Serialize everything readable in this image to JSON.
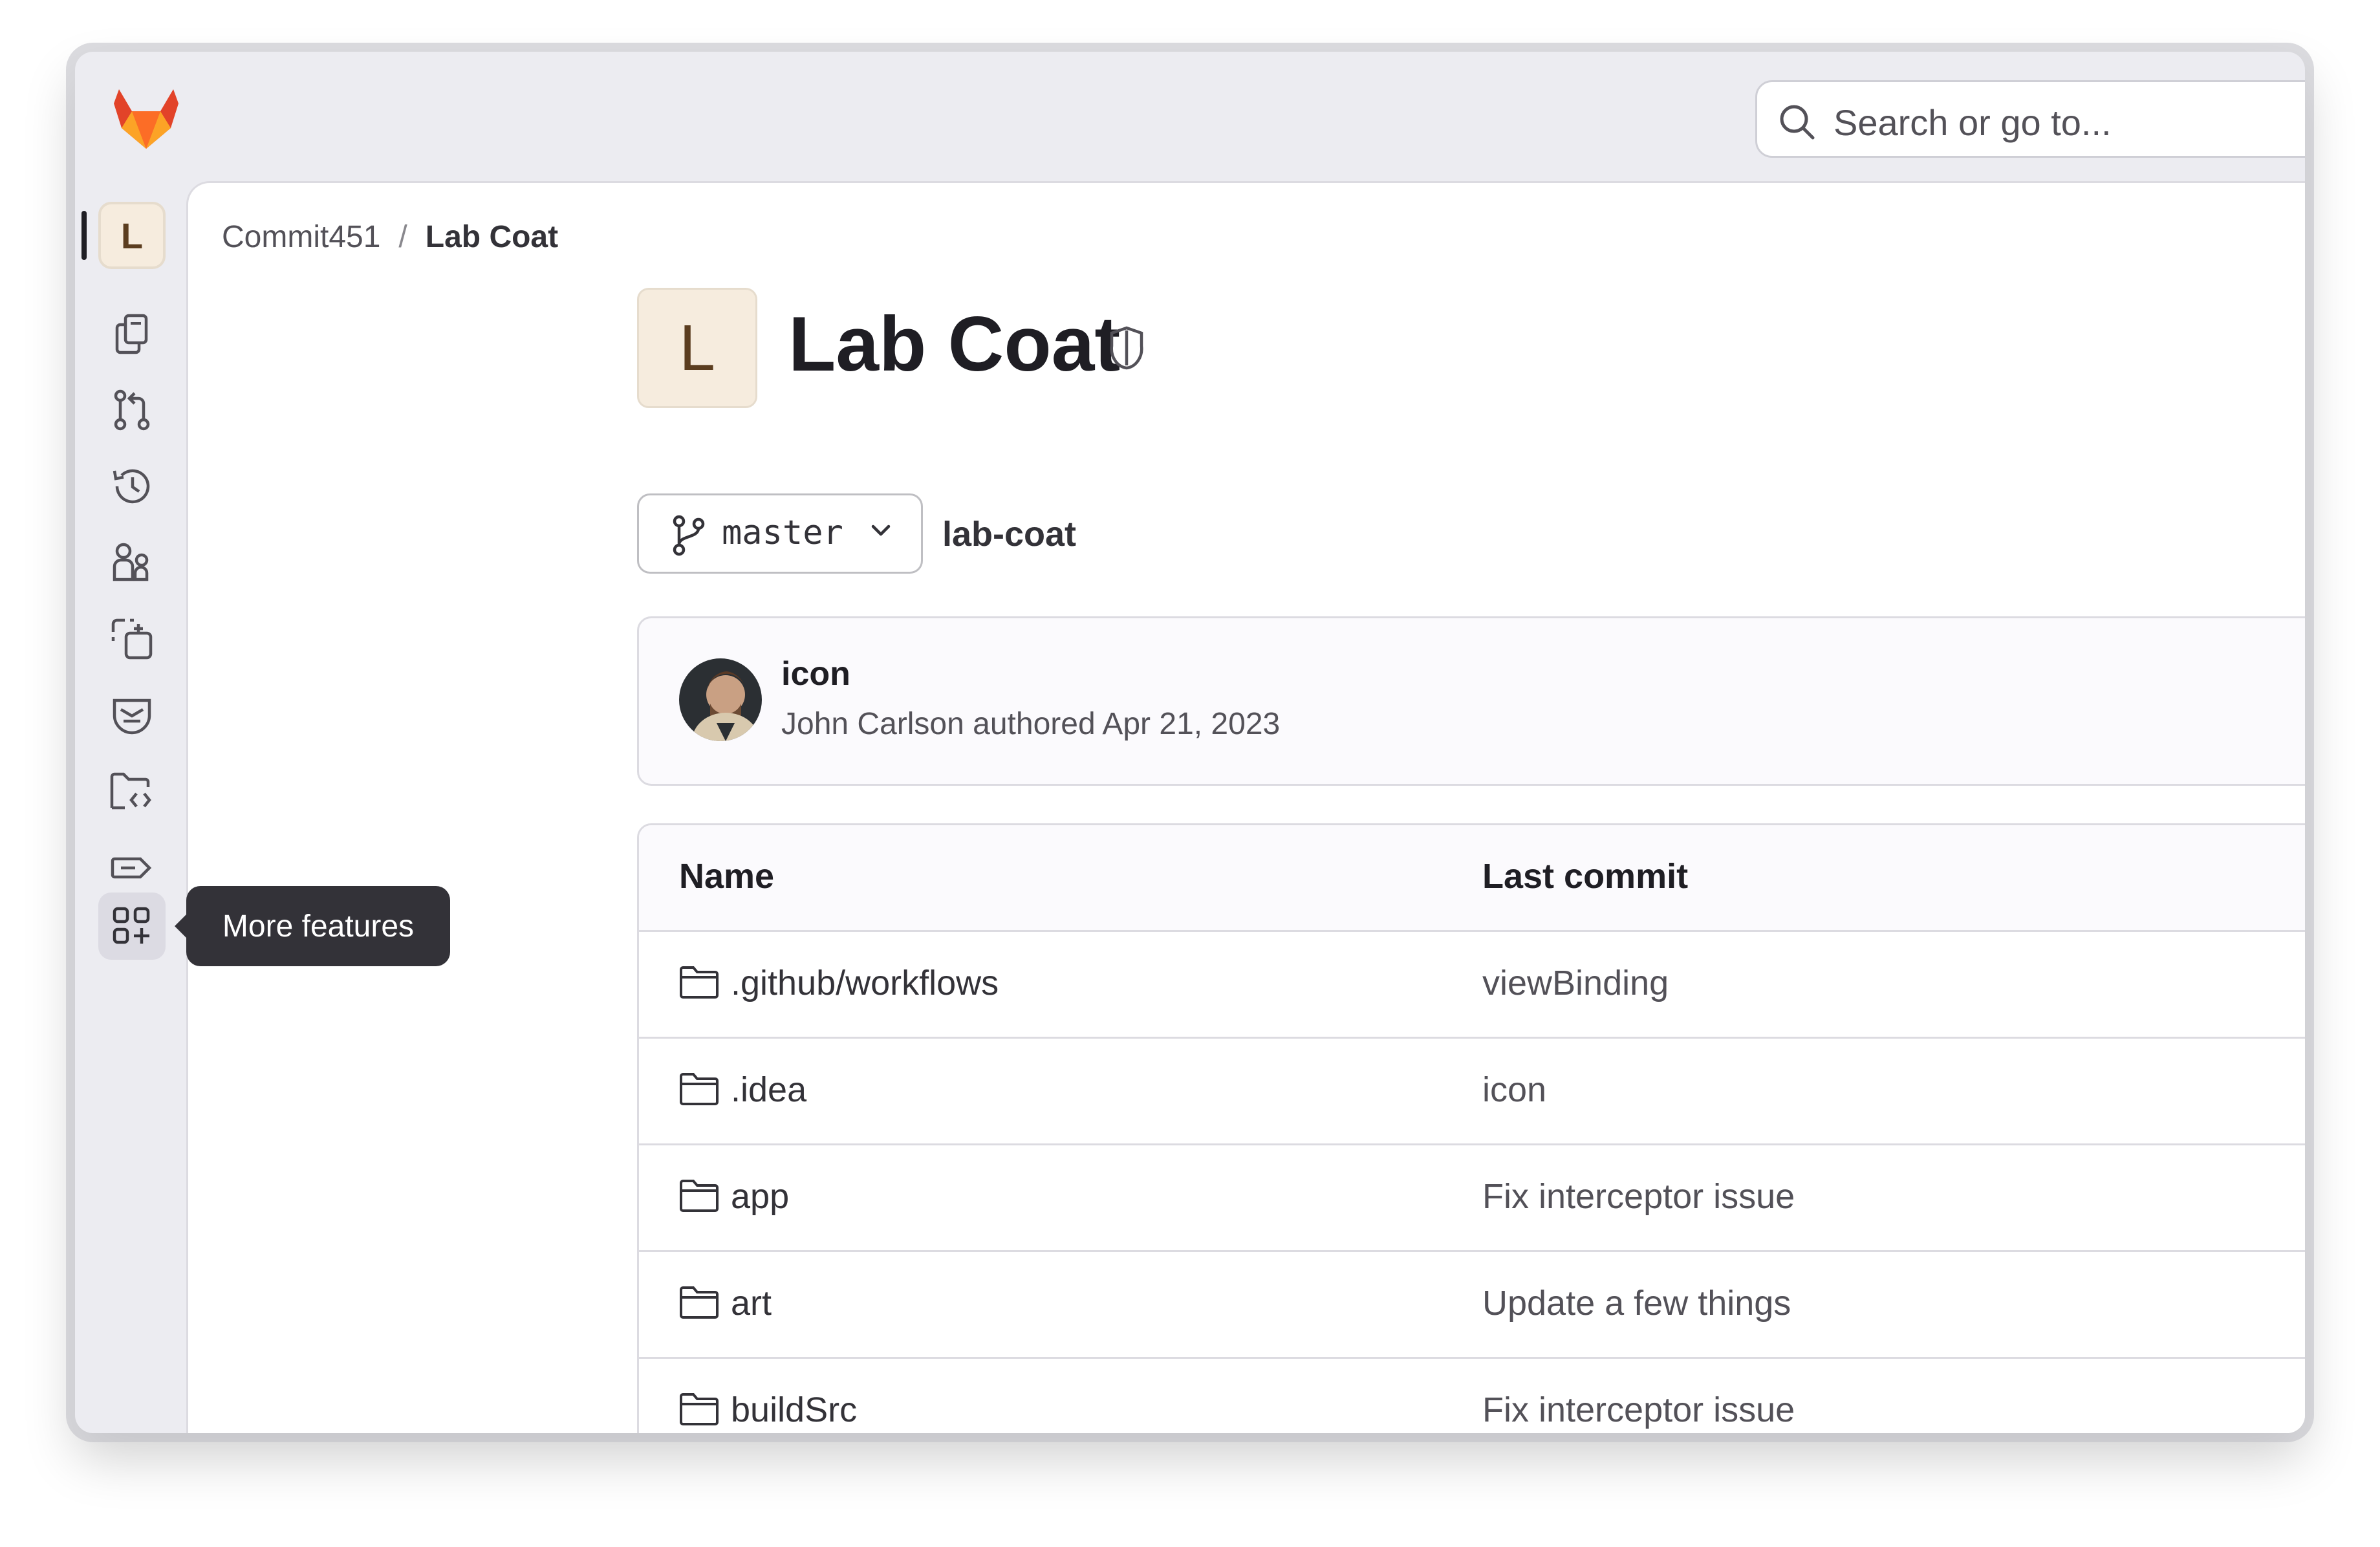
{
  "header": {
    "logo_icon": "gitlab-tanuki-icon",
    "search_placeholder": "Search or go to..."
  },
  "sidebar": {
    "project_initial": "L",
    "items": [
      {
        "name": "project-overview",
        "icon": "project-avatar"
      },
      {
        "name": "pinned",
        "icon": "copy-icon"
      },
      {
        "name": "merge-requests",
        "icon": "merge-request-icon"
      },
      {
        "name": "history",
        "icon": "history-icon"
      },
      {
        "name": "members",
        "icon": "users-icon"
      },
      {
        "name": "plan",
        "icon": "plan-icon"
      },
      {
        "name": "secure",
        "icon": "shield-face-icon"
      },
      {
        "name": "code",
        "icon": "folder-code-icon"
      },
      {
        "name": "deploy",
        "icon": "tag-icon"
      },
      {
        "name": "more-features",
        "icon": "grid-plus-icon"
      }
    ],
    "tooltip": "More features"
  },
  "breadcrumb": {
    "group": "Commit451",
    "separator": "/",
    "project": "Lab Coat"
  },
  "project": {
    "initial": "L",
    "title": "Lab Coat",
    "branch": "master",
    "path": "lab-coat"
  },
  "commit": {
    "title": "icon",
    "meta": "John Carlson authored Apr 21, 2023"
  },
  "files": {
    "columns": [
      "Name",
      "Last commit"
    ],
    "rows": [
      {
        "name": ".github/workflows",
        "last_commit": "viewBinding"
      },
      {
        "name": ".idea",
        "last_commit": "icon"
      },
      {
        "name": "app",
        "last_commit": "Fix interceptor issue"
      },
      {
        "name": "art",
        "last_commit": "Update a few things"
      },
      {
        "name": "buildSrc",
        "last_commit": "Fix interceptor issue"
      }
    ]
  },
  "colors": {
    "brand_orange": "#e24329",
    "accent_avatar_bg": "#f6ecde",
    "tooltip_bg": "#333238"
  }
}
